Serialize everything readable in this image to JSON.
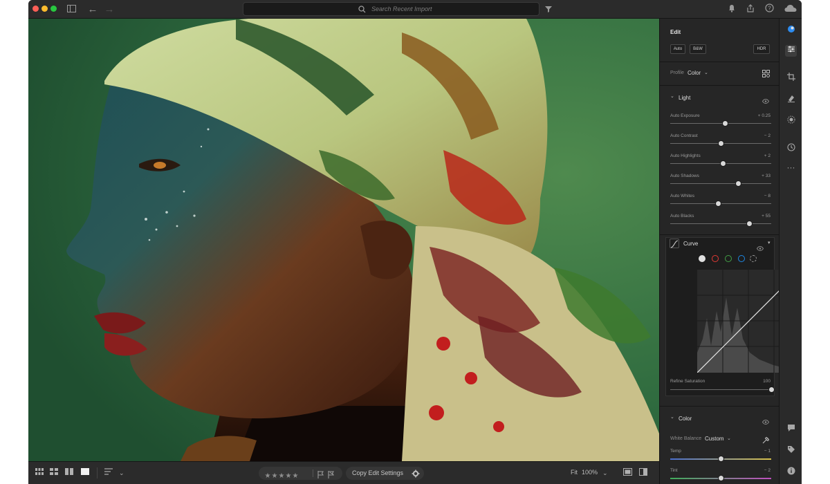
{
  "window": {
    "search_placeholder": "Search Recent Import"
  },
  "edit_panel": {
    "title": "Edit",
    "buttons": {
      "auto": "Auto",
      "bw": "B&W",
      "hdr": "HDR"
    },
    "profile": {
      "label": "Profile",
      "value": "Color"
    },
    "light": {
      "title": "Light",
      "sliders": [
        {
          "label": "Auto Exposure",
          "value": "+ 0.25",
          "position": 0.54
        },
        {
          "label": "Auto Contrast",
          "value": "− 2",
          "position": 0.5
        },
        {
          "label": "Auto Highlights",
          "value": "+ 2",
          "position": 0.52
        },
        {
          "label": "Auto Shadows",
          "value": "+ 33",
          "position": 0.67
        },
        {
          "label": "Auto Whites",
          "value": "− 8",
          "position": 0.47
        },
        {
          "label": "Auto Blacks",
          "value": "+ 55",
          "position": 0.78
        }
      ]
    },
    "curve": {
      "title": "Curve",
      "refine_label": "Refine Saturation",
      "refine_value": "100",
      "refine_position": 1.0
    },
    "color": {
      "title": "Color",
      "white_balance_label": "White Balance",
      "white_balance_value": "Custom",
      "sliders": [
        {
          "label": "Temp",
          "value": "− 1",
          "position": 0.5
        },
        {
          "label": "Tint",
          "value": "− 2",
          "position": 0.5
        }
      ]
    }
  },
  "bottom_bar": {
    "stars": [
      "★",
      "★",
      "★",
      "★",
      "★"
    ],
    "copy_edit": "Copy Edit Settings",
    "fit_label": "Fit",
    "zoom": "100%"
  },
  "colors": {
    "accent_blue": "#2d8cf0",
    "panel_bg": "#262626",
    "photo_green": "#2e6b41"
  }
}
